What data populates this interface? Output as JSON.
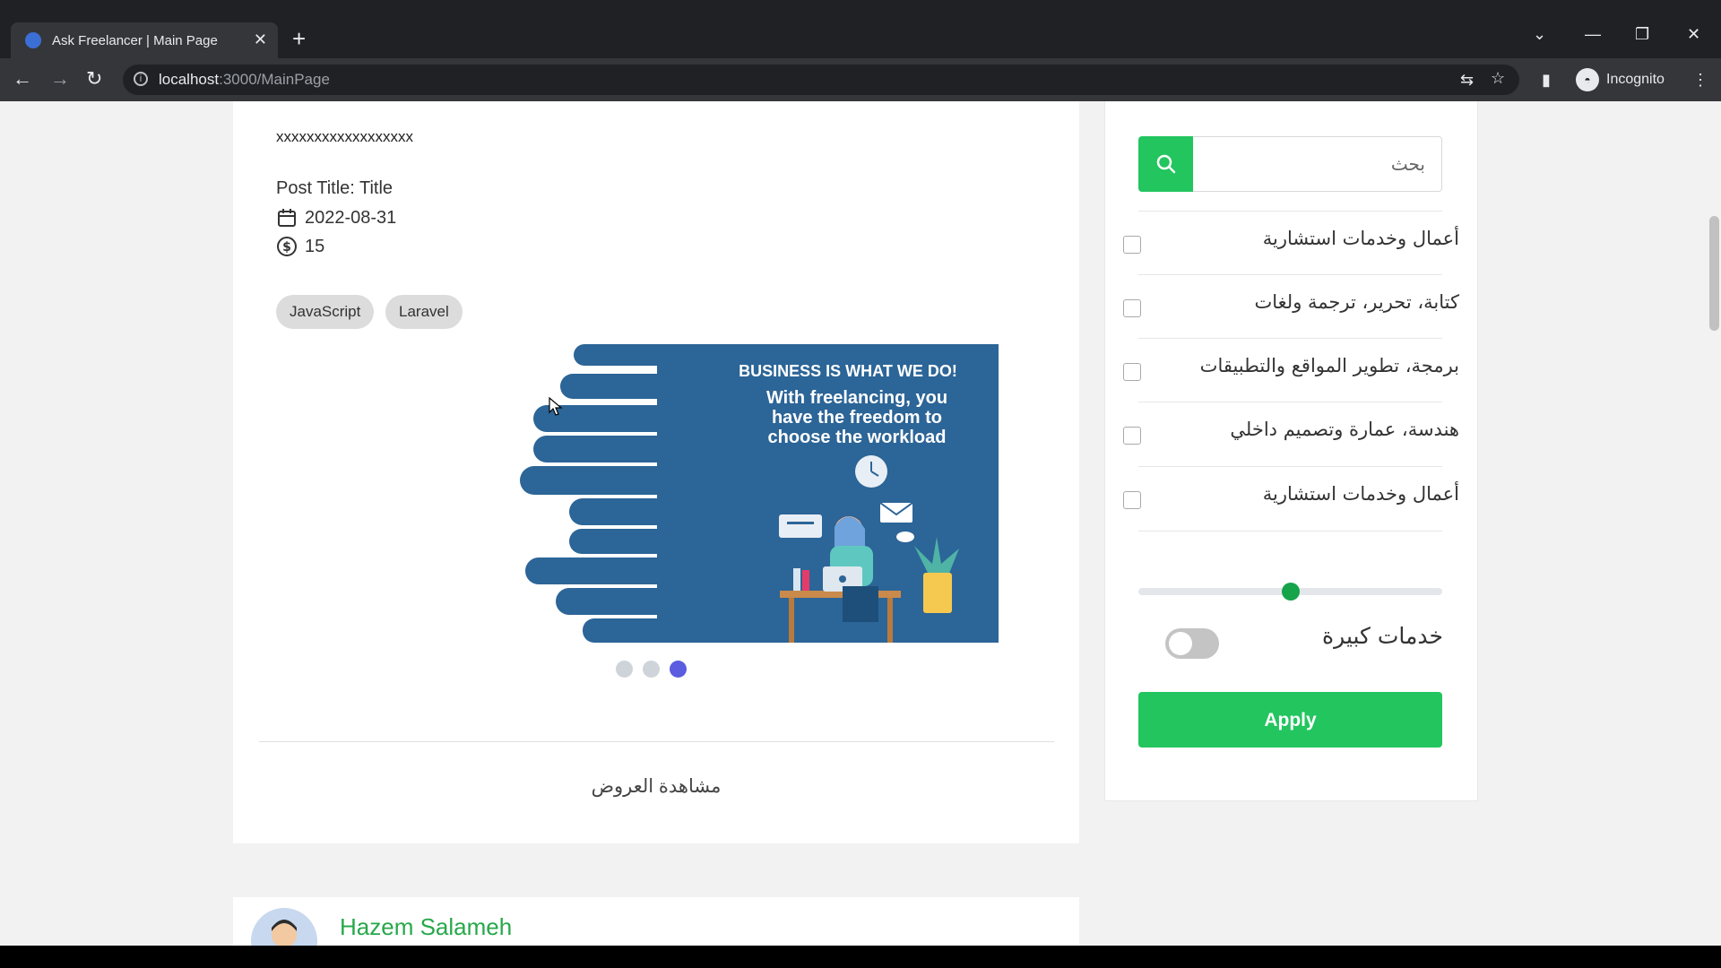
{
  "browser": {
    "tab_title": "Ask Freelancer | Main Page",
    "tab_close": "✕",
    "new_tab": "+",
    "url_host": "localhost",
    "url_path": ":3000/MainPage",
    "profile_label": "Incognito"
  },
  "post": {
    "description": "xxxxxxxxxxxxxxxxxx",
    "title_line": "Post Title: Title",
    "date": "2022-08-31",
    "price": "15",
    "tags": [
      "JavaScript",
      "Laravel"
    ],
    "banner": {
      "headline": "BUSINESS IS WHAT WE DO!",
      "line1": "With freelancing, you",
      "line2": "have the freedom to",
      "line3": "choose the workload",
      "bg_color": "#2c6597"
    },
    "carousel": {
      "count": 3,
      "active": 3
    },
    "view_offers": "مشاهدة العروض"
  },
  "next_post": {
    "author": "Hazem Salameh"
  },
  "sidebar": {
    "search_placeholder": "بحث",
    "categories": [
      "أعمال وخدمات استشارية",
      "كتابة، تحرير، ترجمة ولغات",
      "برمجة، تطوير المواقع والتطبيقات",
      "هندسة، عمارة وتصميم داخلي",
      "أعمال وخدمات استشارية"
    ],
    "slider_value_fraction": 0.5,
    "big_services_label": "خدمات كبيرة",
    "big_services_on": false,
    "apply_label": "Apply"
  },
  "colors": {
    "accent_green": "#22c55e",
    "name_green": "#27a84a",
    "dot_active": "#5b5ce0"
  }
}
